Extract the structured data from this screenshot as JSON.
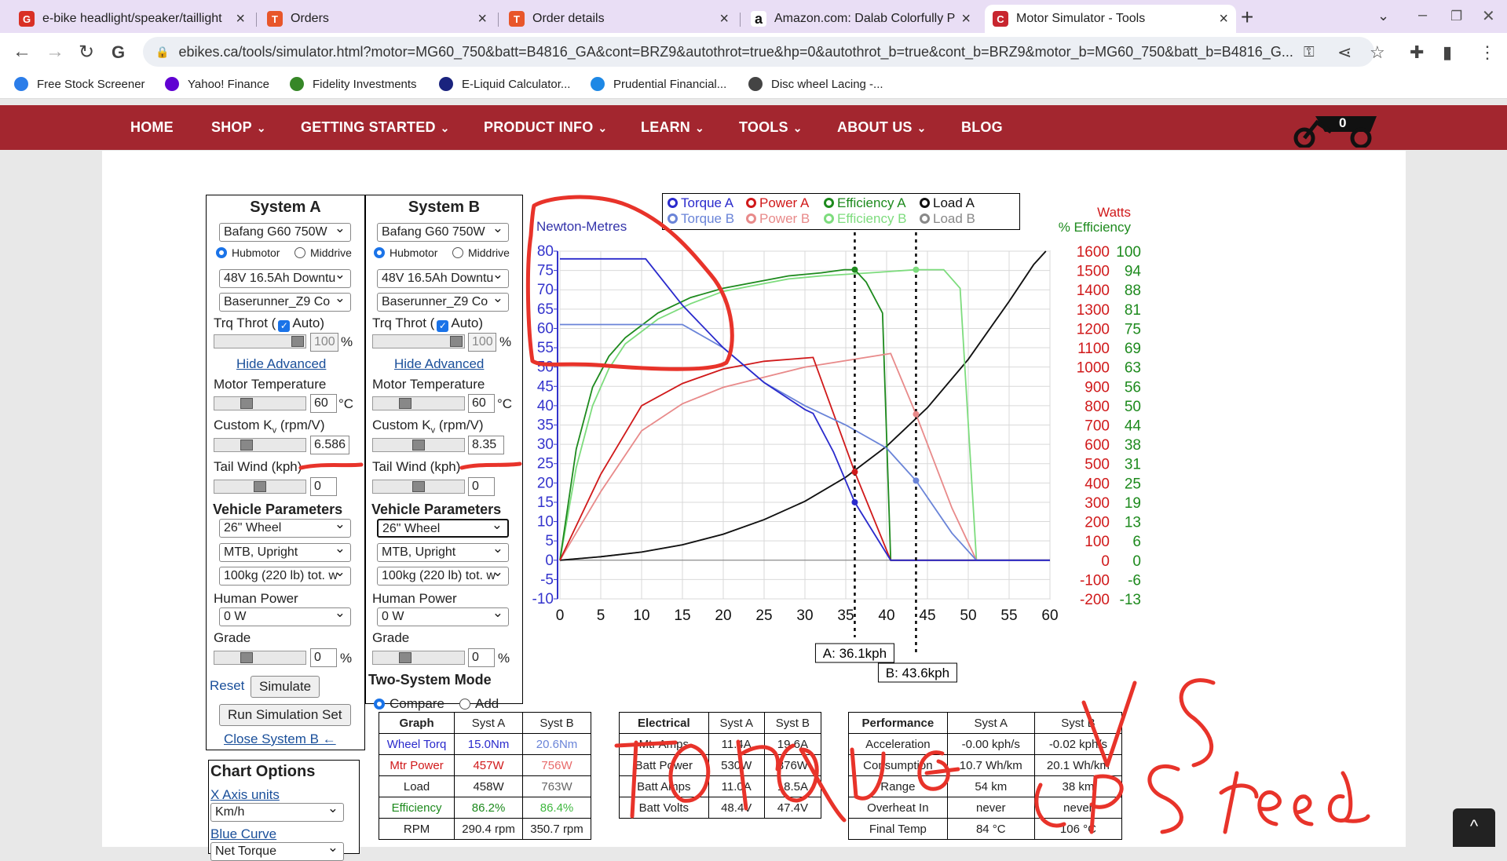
{
  "browser": {
    "tabs": [
      {
        "title": "e-bike headlight/speaker/taillight",
        "fav": "G",
        "color": "#d93025",
        "left": 14,
        "width": 308
      },
      {
        "title": "Orders",
        "fav": "T",
        "color": "#e8562a",
        "left": 330,
        "width": 300
      },
      {
        "title": "Order details",
        "fav": "T",
        "color": "#e8562a",
        "left": 638,
        "width": 300
      },
      {
        "title": "Amazon.com: Dalab Colorfully Pa",
        "fav": "a",
        "color": "#ffffff",
        "left": 946,
        "width": 300
      },
      {
        "title": "Motor Simulator - Tools",
        "fav": "C",
        "color": "#c8262f",
        "left": 1254,
        "width": 320,
        "active": true
      }
    ],
    "url": "ebikes.ca/tools/simulator.html?motor=MG60_750&batt=B4816_GA&cont=BRZ9&autothrot=true&hp=0&autothrot_b=true&cont_b=BRZ9&motor_b=MG60_750&batt_b=B4816_G...",
    "bookmarks": [
      {
        "label": "Free Stock Screener",
        "color": "#2b7de9",
        "left": 18
      },
      {
        "label": "Yahoo! Finance",
        "color": "#6001d2",
        "left": 210
      },
      {
        "label": "Fidelity Investments",
        "color": "#368727",
        "left": 369
      },
      {
        "label": "E-Liquid Calculator...",
        "color": "#1a237e",
        "left": 559
      },
      {
        "label": "Prudential Financial...",
        "color": "#1e88e5",
        "left": 752
      },
      {
        "label": "Disc wheel Lacing -...",
        "color": "#444444",
        "left": 953
      }
    ]
  },
  "site_nav": {
    "items": [
      {
        "label": "HOME",
        "left": 166,
        "dd": false
      },
      {
        "label": "SHOP",
        "left": 269,
        "dd": true
      },
      {
        "label": "GETTING STARTED",
        "left": 383,
        "dd": true
      },
      {
        "label": "PRODUCT INFO",
        "left": 616,
        "dd": true
      },
      {
        "label": "LEARN",
        "left": 816,
        "dd": true
      },
      {
        "label": "TOOLS",
        "left": 941,
        "dd": true
      },
      {
        "label": "ABOUT US",
        "left": 1066,
        "dd": true
      },
      {
        "label": "BLOG",
        "left": 1224,
        "dd": false
      }
    ],
    "cart_count": "0"
  },
  "system_a": {
    "title": "System A",
    "motor": "Bafang G60 750W",
    "hub": "Hubmotor",
    "mid": "Middrive",
    "battery": "48V 16.5Ah Downtu",
    "controller": "Baserunner_Z9 Co",
    "throttle_label_1": "Trq Throt (",
    "throttle_label_2": "Auto)",
    "throttle_pct": "100",
    "pct": "%",
    "hide_advanced": "Hide Advanced",
    "motor_temp_label": "Motor Temperature",
    "motor_temp": "60",
    "deg": "°C",
    "kv_label": "Custom K",
    "kv_sub": "v",
    "kv_unit": " (rpm/V)",
    "kv": "6.586",
    "tailwind_label": "Tail Wind (kph)",
    "tailwind": "0",
    "veh_params": "Vehicle Parameters",
    "wheel": "26\"  Wheel",
    "position": "MTB, Upright",
    "weight": "100kg (220 lb) tot. w",
    "human_power_label": "Human Power",
    "human_power": "0 W",
    "grade_label": "Grade",
    "grade": "0",
    "reset": "Reset",
    "simulate": "Simulate",
    "run_set": "Run Simulation Set",
    "close_b": "Close System B ←"
  },
  "system_b": {
    "title": "System B",
    "motor": "Bafang G60 750W",
    "hub": "Hubmotor",
    "mid": "Middrive",
    "battery": "48V 16.5Ah Downtu",
    "controller": "Baserunner_Z9 Co",
    "throttle_label_1": "Trq Throt (",
    "throttle_label_2": "Auto)",
    "throttle_pct": "100",
    "pct": "%",
    "hide_advanced": "Hide Advanced",
    "motor_temp_label": "Motor Temperature",
    "motor_temp": "60",
    "deg": "°C",
    "kv_label": "Custom K",
    "kv_sub": "v",
    "kv_unit": " (rpm/V)",
    "kv": "8.35",
    "tailwind_label": "Tail Wind (kph)",
    "tailwind": "0",
    "veh_params": "Vehicle Parameters",
    "wheel": "26\"  Wheel",
    "position": "MTB, Upright",
    "weight": "100kg (220 lb) tot. w",
    "human_power_label": "Human Power",
    "human_power": "0 W",
    "grade_label": "Grade",
    "grade": "0",
    "two_system": "Two-System Mode",
    "compare": "Compare",
    "add": "Add"
  },
  "chart_options": {
    "title": "Chart Options",
    "x_axis_units": "X Axis units",
    "x_unit": "Km/h",
    "blue_curve": "Blue Curve",
    "blue_sel": "Net Torque"
  },
  "graph_table": {
    "headers": [
      "Graph",
      "Syst A",
      "Syst B"
    ],
    "rows": [
      {
        "label": "Wheel Torq",
        "a": "15.0Nm",
        "b": "20.6Nm",
        "color": "#2a2acc",
        "bcolor": "#6a84d8"
      },
      {
        "label": "Mtr Power",
        "a": "457W",
        "b": "756W",
        "color": "#d0191a",
        "bcolor": "#e86a6a"
      },
      {
        "label": "Load",
        "a": "458W",
        "b": "763W",
        "color": "#222222",
        "bcolor": "#666666"
      },
      {
        "label": "Efficiency",
        "a": "86.2%",
        "b": "86.4%",
        "color": "#1d8a1d",
        "bcolor": "#3fb83f"
      },
      {
        "label": "RPM",
        "a": "290.4 rpm",
        "b": "350.7 rpm",
        "color": "#222222",
        "bcolor": "#222222"
      }
    ]
  },
  "electrical_table": {
    "headers": [
      "Electrical",
      "Syst A",
      "Syst B"
    ],
    "rows": [
      {
        "label": "Mtr Amps",
        "a": "11.4A",
        "b": "19.6A"
      },
      {
        "label": "Batt Power",
        "a": "530W",
        "b": "876W"
      },
      {
        "label": "Batt Amps",
        "a": "11.0A",
        "b": "18.5A"
      },
      {
        "label": "Batt Volts",
        "a": "48.4V",
        "b": "47.4V"
      }
    ]
  },
  "performance_table": {
    "headers": [
      "Performance",
      "Syst A",
      "Syst B"
    ],
    "rows": [
      {
        "label": "Acceleration",
        "a": "-0.00 kph/s",
        "b": "-0.02 kph/s"
      },
      {
        "label": "Consumption",
        "a": "10.7 Wh/km",
        "b": "20.1 Wh/km"
      },
      {
        "label": "Range",
        "a": "54 km",
        "b": "38 km"
      },
      {
        "label": "Overheat In",
        "a": "never",
        "b": "never"
      },
      {
        "label": "Final Temp",
        "a": "84 °C",
        "b": "106 °C"
      }
    ]
  },
  "legend": [
    {
      "label": "Torque A",
      "color": "#2a2acc"
    },
    {
      "label": "Power A",
      "color": "#d0191a"
    },
    {
      "label": "Efficiency A",
      "color": "#1d8a1d"
    },
    {
      "label": "Load A",
      "color": "#111111"
    },
    {
      "label": "Torque B",
      "color": "#6a84d8"
    },
    {
      "label": "Power B",
      "color": "#e88a8a"
    },
    {
      "label": "Efficiency B",
      "color": "#7ddc7d"
    },
    {
      "label": "Load B",
      "color": "#888888"
    }
  ],
  "chart_data": {
    "type": "line",
    "left_axis_label": "Newton-Metres",
    "right_axis_labels": [
      "Watts",
      "% Efficiency"
    ],
    "xlim": [
      0,
      60
    ],
    "ylim_torque": [
      -10,
      80
    ],
    "ylim_watts": [
      -200,
      1600
    ],
    "x_ticks": [
      0,
      5,
      10,
      15,
      20,
      25,
      30,
      35,
      40,
      45,
      50,
      55,
      60
    ],
    "torque_ticks": [
      "80",
      "75",
      "70",
      "65",
      "60",
      "55",
      "50",
      "45",
      "40",
      "35",
      "30",
      "25",
      "20",
      "15",
      "10",
      "5",
      "0",
      "-5",
      "-10"
    ],
    "watts_ticks": [
      "1600",
      "1500",
      "1400",
      "1300",
      "1200",
      "1100",
      "1000",
      "900",
      "800",
      "700",
      "600",
      "500",
      "400",
      "300",
      "200",
      "100",
      "0",
      "-100",
      "-200"
    ],
    "eff_ticks": [
      "100",
      "94",
      "88",
      "81",
      "75",
      "69",
      "63",
      "56",
      "50",
      "44",
      "38",
      "31",
      "25",
      "19",
      "13",
      "6",
      "0",
      "-6",
      "-13"
    ],
    "markers": [
      {
        "label": "A: 36.1kph",
        "x": 36.1
      },
      {
        "label": "B: 43.6kph",
        "x": 43.6
      }
    ],
    "series": [
      {
        "name": "Torque A",
        "color": "#2a2acc",
        "axis": "torque",
        "points": [
          [
            0,
            78
          ],
          [
            10.5,
            78
          ],
          [
            15,
            66
          ],
          [
            20,
            55
          ],
          [
            25,
            46
          ],
          [
            30,
            39
          ],
          [
            31,
            38
          ],
          [
            33.5,
            28
          ],
          [
            36.1,
            15
          ],
          [
            40.5,
            0
          ],
          [
            60,
            0
          ]
        ]
      },
      {
        "name": "Torque B",
        "color": "#6a84d8",
        "axis": "torque",
        "points": [
          [
            0,
            61
          ],
          [
            15,
            61
          ],
          [
            20,
            55
          ],
          [
            25,
            46
          ],
          [
            30,
            40
          ],
          [
            35,
            35
          ],
          [
            40,
            29
          ],
          [
            43.6,
            20.6
          ],
          [
            48,
            7
          ],
          [
            51,
            0
          ],
          [
            60,
            0
          ]
        ]
      },
      {
        "name": "Power A",
        "color": "#d0191a",
        "axis": "watts",
        "points": [
          [
            0,
            0
          ],
          [
            5,
            445
          ],
          [
            10,
            800
          ],
          [
            15,
            915
          ],
          [
            20,
            990
          ],
          [
            25,
            1030
          ],
          [
            31,
            1050
          ],
          [
            36.1,
            457
          ],
          [
            40.5,
            0
          ],
          [
            60,
            0
          ]
        ]
      },
      {
        "name": "Power B",
        "color": "#e88a8a",
        "axis": "watts",
        "points": [
          [
            0,
            0
          ],
          [
            5,
            355
          ],
          [
            10,
            670
          ],
          [
            15,
            810
          ],
          [
            20,
            895
          ],
          [
            30,
            1000
          ],
          [
            40.5,
            1070
          ],
          [
            43.6,
            756
          ],
          [
            48,
            270
          ],
          [
            51,
            0
          ],
          [
            60,
            0
          ]
        ]
      },
      {
        "name": "Efficiency A",
        "color": "#1d8a1d",
        "axis": "eff",
        "points": [
          [
            0,
            0
          ],
          [
            2,
            36
          ],
          [
            4,
            56
          ],
          [
            6,
            66
          ],
          [
            8,
            72
          ],
          [
            12,
            80
          ],
          [
            16,
            85
          ],
          [
            20,
            88
          ],
          [
            24,
            90
          ],
          [
            28,
            92
          ],
          [
            32,
            93
          ],
          [
            34.8,
            94
          ],
          [
            36.1,
            94
          ],
          [
            37.5,
            90
          ],
          [
            39.5,
            80
          ],
          [
            40.5,
            0
          ],
          [
            60,
            0
          ]
        ]
      },
      {
        "name": "Efficiency B",
        "color": "#7ddc7d",
        "axis": "eff",
        "points": [
          [
            0,
            0
          ],
          [
            2,
            30
          ],
          [
            4,
            50
          ],
          [
            6,
            62
          ],
          [
            8,
            70
          ],
          [
            12,
            78
          ],
          [
            16,
            83
          ],
          [
            20,
            87
          ],
          [
            24,
            89
          ],
          [
            28,
            91
          ],
          [
            32,
            92
          ],
          [
            38,
            93
          ],
          [
            43.6,
            94
          ],
          [
            47,
            94
          ],
          [
            49,
            88
          ],
          [
            51,
            0
          ],
          [
            60,
            0
          ]
        ]
      },
      {
        "name": "Load A",
        "color": "#111111",
        "axis": "watts",
        "points": [
          [
            0,
            0
          ],
          [
            5,
            18
          ],
          [
            10,
            42
          ],
          [
            15,
            80
          ],
          [
            20,
            135
          ],
          [
            25,
            210
          ],
          [
            30,
            305
          ],
          [
            35,
            430
          ],
          [
            40,
            590
          ],
          [
            45,
            790
          ],
          [
            50,
            1040
          ],
          [
            55,
            1340
          ],
          [
            58,
            1530
          ],
          [
            59.5,
            1600
          ]
        ]
      },
      {
        "name": "Load B",
        "color": "#888888",
        "axis": "watts",
        "points": [
          [
            0,
            0
          ],
          [
            5,
            18
          ],
          [
            10,
            42
          ],
          [
            15,
            80
          ],
          [
            20,
            135
          ],
          [
            25,
            210
          ],
          [
            30,
            305
          ],
          [
            35,
            430
          ],
          [
            40,
            590
          ],
          [
            45,
            790
          ],
          [
            50,
            1040
          ],
          [
            55,
            1340
          ],
          [
            58,
            1530
          ],
          [
            59.5,
            1600
          ]
        ]
      }
    ],
    "dots": [
      {
        "x": 36.1,
        "y": 94,
        "axis": "eff",
        "color": "#1d8a1d"
      },
      {
        "x": 36.1,
        "y": 457,
        "axis": "watts",
        "color": "#d0191a"
      },
      {
        "x": 36.1,
        "y": 15,
        "axis": "torque",
        "color": "#2a2acc"
      },
      {
        "x": 43.6,
        "y": 94,
        "axis": "eff",
        "color": "#7ddc7d"
      },
      {
        "x": 43.6,
        "y": 756,
        "axis": "watts",
        "color": "#e88a8a"
      },
      {
        "x": 43.6,
        "y": 20.6,
        "axis": "torque",
        "color": "#6a84d8"
      }
    ]
  }
}
